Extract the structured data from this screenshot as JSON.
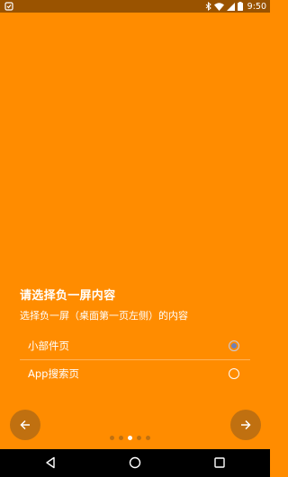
{
  "status_bar": {
    "time": "9:50",
    "icons": [
      "app-notification-icon",
      "bluetooth-icon",
      "wifi-icon",
      "signal-icon",
      "battery-icon"
    ]
  },
  "colors": {
    "background": "#FF8C00",
    "status_bar": "#9A5300",
    "accent_radio": "#7080B8",
    "nav_button": "#C07010"
  },
  "page": {
    "title": "请选择负一屏内容",
    "subtitle": "选择负一屏（桌面第一页左侧）的内容",
    "options": [
      {
        "label": "小部件页",
        "selected": true
      },
      {
        "label": "App搜索页",
        "selected": false
      }
    ]
  },
  "pager": {
    "total": 5,
    "current": 3,
    "prev_icon": "arrow-left-icon",
    "next_icon": "arrow-right-icon"
  },
  "system_nav": {
    "icons": [
      "back-icon",
      "home-icon",
      "recents-icon"
    ]
  }
}
